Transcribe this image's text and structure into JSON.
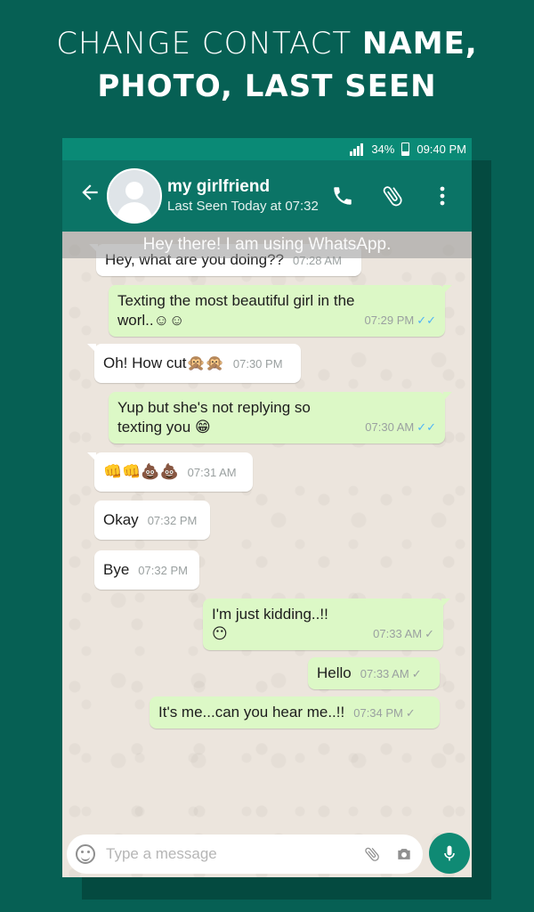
{
  "promo": {
    "line1_thin": "CHANGE CONTACT",
    "line1_bold": "NAME,",
    "line2": "PHOTO, LAST SEEN"
  },
  "statusbar": {
    "battery": "34%",
    "time": "09:40 PM"
  },
  "header": {
    "contact_name": "my girlfriend",
    "last_seen": "Last Seen Today at 07:32",
    "icons": [
      "back-arrow-icon",
      "phone-icon",
      "paperclip-icon",
      "more-vert-icon"
    ]
  },
  "chat": {
    "about_banner": "Hey there! I am using WhatsApp.",
    "messages": [
      {
        "dir": "in",
        "text": "Hey, what are you doing??",
        "time": "07:28 AM"
      },
      {
        "dir": "out",
        "text": "Texting the most beautiful girl in the worl..☺☺",
        "time": "07:29 PM",
        "status": "read"
      },
      {
        "dir": "in",
        "text": "Oh! How cut🙊🙊",
        "time": "07:30 PM"
      },
      {
        "dir": "out",
        "text": "Yup but she's not replying so texting you 😁",
        "time": "07:30 AM",
        "status": "read"
      },
      {
        "dir": "in",
        "text": "👊👊💩💩",
        "time": "07:31 AM"
      },
      {
        "dir": "in",
        "text": "Okay",
        "time": "07:32 PM"
      },
      {
        "dir": "in",
        "text": "Bye",
        "time": "07:32 PM"
      },
      {
        "dir": "out",
        "text": "I'm just kidding..!! 😶",
        "time": "07:33 AM",
        "status": "sent"
      },
      {
        "dir": "out",
        "text": "Hello",
        "time": "07:33 AM",
        "status": "sent"
      },
      {
        "dir": "out",
        "text": "It's me...can you hear me..!!",
        "time": "07:34 PM",
        "status": "sent"
      }
    ]
  },
  "composer": {
    "placeholder": "Type a message"
  },
  "colors": {
    "background": "#066054",
    "header": "#0b7466",
    "outgoing_bubble": "#dcf8c6",
    "incoming_bubble": "#ffffff",
    "read_tick": "#4fb3f6"
  }
}
